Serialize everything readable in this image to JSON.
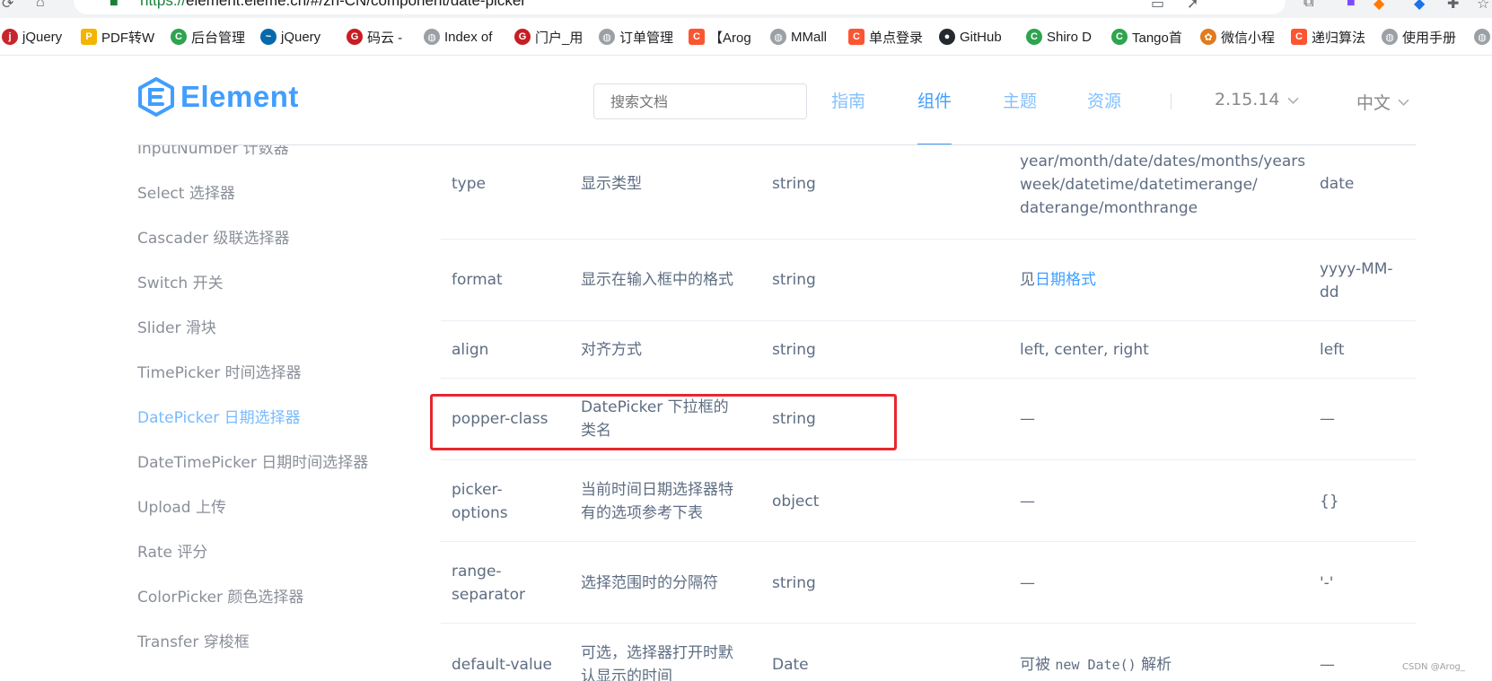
{
  "browser": {
    "url_scheme": "https://",
    "url_rest": "element.eleme.cn/#/zh-CN/component/date-picker",
    "bookmarks": [
      {
        "label": "jQuery",
        "icon": "jquery-icon",
        "color": "#c7262c"
      },
      {
        "label": "PDF转W",
        "icon": "pdf-convert-icon",
        "color": "#f4b400"
      },
      {
        "label": "后台管理",
        "icon": "c-logo-icon",
        "color": "#2ea44f"
      },
      {
        "label": "jQuery",
        "icon": "jquery-swirl-icon",
        "color": "#0769ad"
      },
      {
        "label": "码云 -",
        "icon": "gitee-icon",
        "color": "#c71d23"
      },
      {
        "label": "Index of",
        "icon": "globe-icon",
        "color": "#9aa0a6"
      },
      {
        "label": "门户_用",
        "icon": "gitee-icon",
        "color": "#c71d23"
      },
      {
        "label": "订单管理",
        "icon": "globe-icon",
        "color": "#9aa0a6"
      },
      {
        "label": "【Arog",
        "icon": "csdn-icon",
        "color": "#fc5531"
      },
      {
        "label": "MMall",
        "icon": "globe-icon",
        "color": "#9aa0a6"
      },
      {
        "label": "单点登录",
        "icon": "csdn-icon",
        "color": "#fc5531"
      },
      {
        "label": "GitHub",
        "icon": "github-icon",
        "color": "#24292f"
      },
      {
        "label": "Shiro D",
        "icon": "c-logo-icon",
        "color": "#2ea44f"
      },
      {
        "label": "Tango首",
        "icon": "c-logo-icon",
        "color": "#2ea44f"
      },
      {
        "label": "微信小程",
        "icon": "wechat-mini-icon",
        "color": "#e07b1f"
      },
      {
        "label": "递归算法",
        "icon": "csdn-icon",
        "color": "#fc5531"
      },
      {
        "label": "使用手册",
        "icon": "globe-icon",
        "color": "#9aa0a6"
      },
      {
        "label": "",
        "icon": "globe-icon",
        "color": "#9aa0a6"
      }
    ]
  },
  "header": {
    "logo_text": "Element",
    "search_placeholder": "搜索文档",
    "nav": [
      "指南",
      "组件",
      "主题",
      "资源"
    ],
    "active_nav": "组件",
    "version": "2.15.14",
    "language": "中文"
  },
  "sidebar": {
    "items": [
      "InputNumber 计数器",
      "Select 选择器",
      "Cascader 级联选择器",
      "Switch 开关",
      "Slider 滑块",
      "TimePicker 时间选择器",
      "DatePicker 日期选择器",
      "DateTimePicker 日期时间选择器",
      "Upload 上传",
      "Rate 评分",
      "ColorPicker 颜色选择器",
      "Transfer 穿梭框"
    ],
    "active_item": "DatePicker 日期选择器"
  },
  "table": {
    "rows": [
      {
        "name": "type",
        "desc": "显示类型",
        "type": "string",
        "options": "year/month/date/dates/months/years week/datetime/datetimerange/ daterange/monthrange",
        "default": "date"
      },
      {
        "name": "format",
        "desc": "显示在输入框中的格式",
        "type": "string",
        "options_prefix": "见",
        "options_link": "日期格式",
        "default": "yyyy-MM-dd"
      },
      {
        "name": "align",
        "desc": "对齐方式",
        "type": "string",
        "options": "left, center, right",
        "default": "left"
      },
      {
        "name": "popper-class",
        "desc": "DatePicker 下拉框的类名",
        "type": "string",
        "options": "—",
        "default": "—"
      },
      {
        "name": "picker-options",
        "desc": "当前时间日期选择器特有的选项参考下表",
        "type": "object",
        "options": "—",
        "default": "{}"
      },
      {
        "name": "range-separator",
        "desc": "选择范围时的分隔符",
        "type": "string",
        "options": "—",
        "default": "'-'"
      },
      {
        "name": "default-value",
        "desc": "可选，选择器打开时默认显示的时间",
        "type": "Date",
        "options_prefix": "可被 ",
        "options_code": "new Date()",
        "options_suffix": " 解析",
        "default": "—"
      }
    ]
  },
  "watermark": "CSDN @Arog_",
  "colors": {
    "accent": "#409eff",
    "highlight": "#e8262d",
    "text": "#5e6d82",
    "sidebar_text": "#8a8f99"
  }
}
